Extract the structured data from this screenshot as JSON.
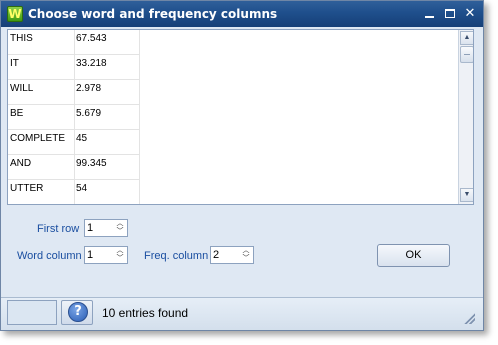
{
  "window": {
    "title": "Choose word and frequency columns",
    "app_icon_letter": "W"
  },
  "list": {
    "rows": [
      {
        "word": "THIS",
        "freq": "67.543"
      },
      {
        "word": "IT",
        "freq": "33.218"
      },
      {
        "word": "WILL",
        "freq": "2.978"
      },
      {
        "word": "BE",
        "freq": "5.679"
      },
      {
        "word": "COMPLETE",
        "freq": "45"
      },
      {
        "word": "AND",
        "freq": "99.345"
      },
      {
        "word": "UTTER",
        "freq": "54"
      }
    ]
  },
  "form": {
    "first_row_label": "First row",
    "first_row_value": "1",
    "word_column_label": "Word column",
    "word_column_value": "1",
    "freq_column_label": "Freq. column",
    "freq_column_value": "2",
    "ok_label": "OK"
  },
  "status": {
    "message": "10 entries found"
  },
  "icons": {
    "minimize": "minimize-icon",
    "maximize": "maximize-icon",
    "close": "close-icon",
    "help": "help-icon",
    "scroll_up": "scroll-up-icon",
    "scroll_down": "scroll-down-icon",
    "spin_up": "spin-up-icon",
    "spin_down": "spin-down-icon"
  },
  "colors": {
    "title_bar": "#1f4f8c",
    "label_blue": "#1a4ea0",
    "window_bg": "#dfe8f3"
  }
}
